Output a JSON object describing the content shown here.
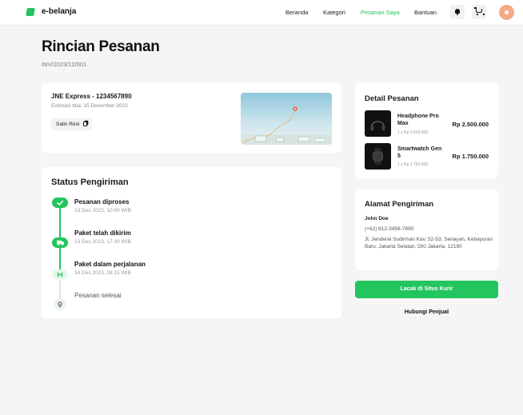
{
  "nav": {
    "brand": "e-belanja",
    "links": [
      "Beranda",
      "Kategori",
      "Pesanan Saya",
      "Bantuan"
    ],
    "active_link": "Pesanan Saya",
    "accent_color": "#22c55e"
  },
  "page": {
    "title": "Rincian Pesanan",
    "invoice": "INV/2023/12/001"
  },
  "shipping": {
    "courier": "JNE Express - 1234567890",
    "estimate": "Estimasi tiba: 15 Desember 2023",
    "copy_label": "Salin Resi"
  },
  "status": {
    "title": "Status Pengiriman",
    "steps": [
      {
        "name": "Pesanan diproses",
        "time": "13 Des 2023, 10:00 WIB",
        "icon": "check-icon",
        "state": "done"
      },
      {
        "name": "Paket telah dikirim",
        "time": "13 Des 2023, 17:30 WIB",
        "icon": "truck-icon",
        "state": "done"
      },
      {
        "name": "Paket dalam perjalanan",
        "time": "14 Des 2023, 08:15 WIB",
        "icon": "route-icon",
        "state": "current"
      },
      {
        "name": "Pesanan selesai",
        "time": "",
        "icon": "location-pin-icon",
        "state": "pending"
      }
    ]
  },
  "order_detail": {
    "title": "Detail Pesanan",
    "items": [
      {
        "name": "Headphone Pro Max",
        "qty": "1 x Rp 2.500.000",
        "price": "Rp 2.500.000"
      },
      {
        "name": "Smartwatch Gen 5",
        "qty": "1 x Rp 1.750.000",
        "price": "Rp 1.750.000"
      }
    ]
  },
  "address": {
    "title": "Alamat Pengiriman",
    "name": "John Doe",
    "phone": "(+62) 812-3456-7890",
    "text": "Jl. Jenderal Sudirman Kav. 52-53, Senayan, Kebayoran Baru, Jakarta Selatan, DKI Jakarta, 12190"
  },
  "actions": {
    "track_label": "Lacak di Situs Kurir",
    "contact_label": "Hubungi Penjual"
  }
}
